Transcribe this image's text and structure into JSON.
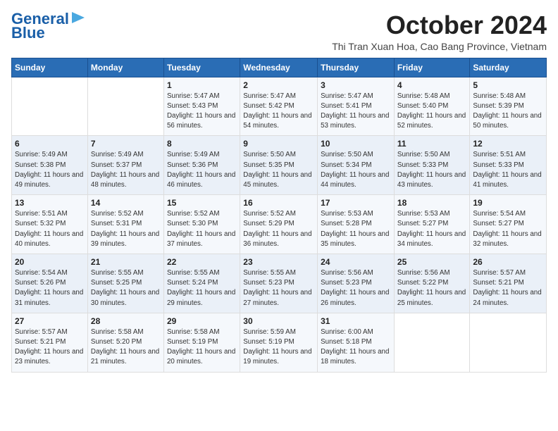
{
  "header": {
    "logo_line1": "General",
    "logo_line2": "Blue",
    "month": "October 2024",
    "location": "Thi Tran Xuan Hoa, Cao Bang Province, Vietnam"
  },
  "days_of_week": [
    "Sunday",
    "Monday",
    "Tuesday",
    "Wednesday",
    "Thursday",
    "Friday",
    "Saturday"
  ],
  "weeks": [
    [
      {
        "day": "",
        "info": ""
      },
      {
        "day": "",
        "info": ""
      },
      {
        "day": "1",
        "info": "Sunrise: 5:47 AM\nSunset: 5:43 PM\nDaylight: 11 hours and 56 minutes."
      },
      {
        "day": "2",
        "info": "Sunrise: 5:47 AM\nSunset: 5:42 PM\nDaylight: 11 hours and 54 minutes."
      },
      {
        "day": "3",
        "info": "Sunrise: 5:47 AM\nSunset: 5:41 PM\nDaylight: 11 hours and 53 minutes."
      },
      {
        "day": "4",
        "info": "Sunrise: 5:48 AM\nSunset: 5:40 PM\nDaylight: 11 hours and 52 minutes."
      },
      {
        "day": "5",
        "info": "Sunrise: 5:48 AM\nSunset: 5:39 PM\nDaylight: 11 hours and 50 minutes."
      }
    ],
    [
      {
        "day": "6",
        "info": "Sunrise: 5:49 AM\nSunset: 5:38 PM\nDaylight: 11 hours and 49 minutes."
      },
      {
        "day": "7",
        "info": "Sunrise: 5:49 AM\nSunset: 5:37 PM\nDaylight: 11 hours and 48 minutes."
      },
      {
        "day": "8",
        "info": "Sunrise: 5:49 AM\nSunset: 5:36 PM\nDaylight: 11 hours and 46 minutes."
      },
      {
        "day": "9",
        "info": "Sunrise: 5:50 AM\nSunset: 5:35 PM\nDaylight: 11 hours and 45 minutes."
      },
      {
        "day": "10",
        "info": "Sunrise: 5:50 AM\nSunset: 5:34 PM\nDaylight: 11 hours and 44 minutes."
      },
      {
        "day": "11",
        "info": "Sunrise: 5:50 AM\nSunset: 5:33 PM\nDaylight: 11 hours and 43 minutes."
      },
      {
        "day": "12",
        "info": "Sunrise: 5:51 AM\nSunset: 5:33 PM\nDaylight: 11 hours and 41 minutes."
      }
    ],
    [
      {
        "day": "13",
        "info": "Sunrise: 5:51 AM\nSunset: 5:32 PM\nDaylight: 11 hours and 40 minutes."
      },
      {
        "day": "14",
        "info": "Sunrise: 5:52 AM\nSunset: 5:31 PM\nDaylight: 11 hours and 39 minutes."
      },
      {
        "day": "15",
        "info": "Sunrise: 5:52 AM\nSunset: 5:30 PM\nDaylight: 11 hours and 37 minutes."
      },
      {
        "day": "16",
        "info": "Sunrise: 5:52 AM\nSunset: 5:29 PM\nDaylight: 11 hours and 36 minutes."
      },
      {
        "day": "17",
        "info": "Sunrise: 5:53 AM\nSunset: 5:28 PM\nDaylight: 11 hours and 35 minutes."
      },
      {
        "day": "18",
        "info": "Sunrise: 5:53 AM\nSunset: 5:27 PM\nDaylight: 11 hours and 34 minutes."
      },
      {
        "day": "19",
        "info": "Sunrise: 5:54 AM\nSunset: 5:27 PM\nDaylight: 11 hours and 32 minutes."
      }
    ],
    [
      {
        "day": "20",
        "info": "Sunrise: 5:54 AM\nSunset: 5:26 PM\nDaylight: 11 hours and 31 minutes."
      },
      {
        "day": "21",
        "info": "Sunrise: 5:55 AM\nSunset: 5:25 PM\nDaylight: 11 hours and 30 minutes."
      },
      {
        "day": "22",
        "info": "Sunrise: 5:55 AM\nSunset: 5:24 PM\nDaylight: 11 hours and 29 minutes."
      },
      {
        "day": "23",
        "info": "Sunrise: 5:55 AM\nSunset: 5:23 PM\nDaylight: 11 hours and 27 minutes."
      },
      {
        "day": "24",
        "info": "Sunrise: 5:56 AM\nSunset: 5:23 PM\nDaylight: 11 hours and 26 minutes."
      },
      {
        "day": "25",
        "info": "Sunrise: 5:56 AM\nSunset: 5:22 PM\nDaylight: 11 hours and 25 minutes."
      },
      {
        "day": "26",
        "info": "Sunrise: 5:57 AM\nSunset: 5:21 PM\nDaylight: 11 hours and 24 minutes."
      }
    ],
    [
      {
        "day": "27",
        "info": "Sunrise: 5:57 AM\nSunset: 5:21 PM\nDaylight: 11 hours and 23 minutes."
      },
      {
        "day": "28",
        "info": "Sunrise: 5:58 AM\nSunset: 5:20 PM\nDaylight: 11 hours and 21 minutes."
      },
      {
        "day": "29",
        "info": "Sunrise: 5:58 AM\nSunset: 5:19 PM\nDaylight: 11 hours and 20 minutes."
      },
      {
        "day": "30",
        "info": "Sunrise: 5:59 AM\nSunset: 5:19 PM\nDaylight: 11 hours and 19 minutes."
      },
      {
        "day": "31",
        "info": "Sunrise: 6:00 AM\nSunset: 5:18 PM\nDaylight: 11 hours and 18 minutes."
      },
      {
        "day": "",
        "info": ""
      },
      {
        "day": "",
        "info": ""
      }
    ]
  ]
}
